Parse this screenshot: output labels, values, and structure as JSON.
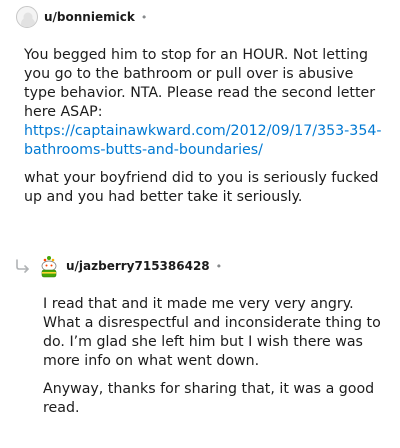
{
  "comments": [
    {
      "username": "u/bonniemick",
      "separator": "•",
      "avatar_icon": "default-snoo-avatar-icon",
      "paragraphs": [
        "You begged him to stop for an HOUR. Not letting you go to the bathroom or pull over is abusive type behavior. NTA. Please read the second letter here ASAP:"
      ],
      "link": "https://captainawkward.com/2012/09/17/353-354-bathrooms-butts-and-boundaries/",
      "after_link": "what your boyfriend did to you is seriously fucked up and you had better take it seriously."
    },
    {
      "username": "u/jazberry715386428",
      "separator": "•",
      "avatar_icon": "cake-avatar-icon",
      "reply_icon": "reply-arrow-icon",
      "paragraphs": [
        "I read that and it made me very very angry. What a disrespectful and inconsiderate thing to do. I’m glad she left him but I wish there was more info on what went down.",
        "Anyway, thanks for sharing that, it was a good read."
      ]
    }
  ],
  "colors": {
    "link": "#0079d3",
    "text": "#1c1c1c",
    "meta": "#878a8c"
  }
}
